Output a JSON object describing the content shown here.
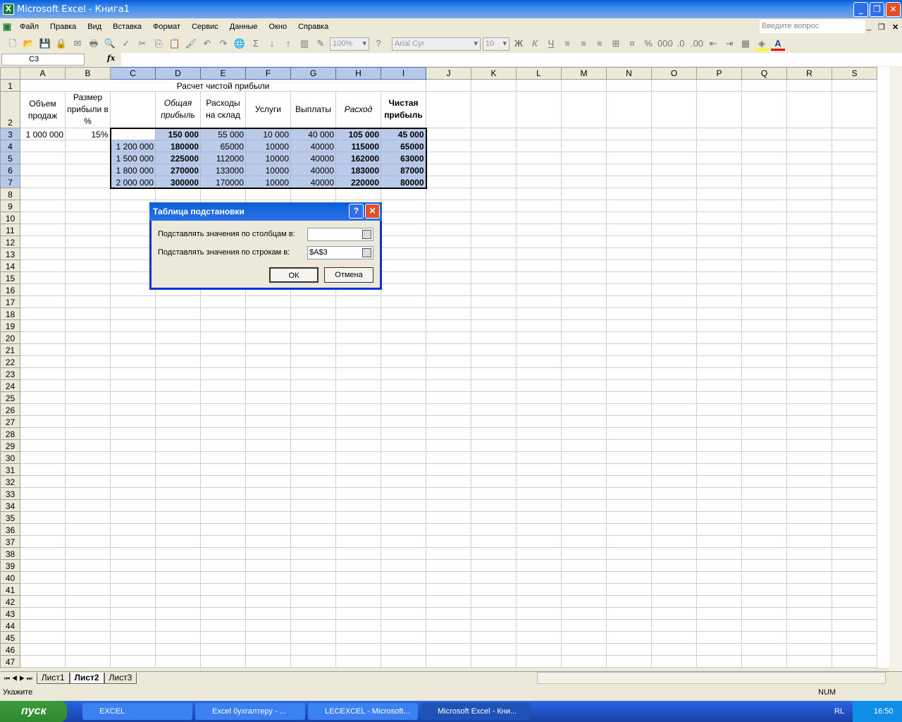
{
  "window": {
    "title": "Microsoft Excel - Книга1",
    "minimize": "_",
    "restore": "❐",
    "close": "✕"
  },
  "menu": [
    "Файл",
    "Правка",
    "Вид",
    "Вставка",
    "Формат",
    "Сервис",
    "Данные",
    "Окно",
    "Справка"
  ],
  "ask_placeholder": "Введите вопрос",
  "toolbar": {
    "zoom": "100%",
    "font": "Arial Cyr",
    "size": "10",
    "bold": "Ж",
    "italic": "К",
    "underline": "Ч"
  },
  "namebox": "C3",
  "fx": "fx",
  "columns": [
    "A",
    "B",
    "C",
    "D",
    "E",
    "F",
    "G",
    "H",
    "I",
    "J",
    "K",
    "L",
    "M",
    "N",
    "O",
    "P",
    "Q",
    "R",
    "S"
  ],
  "selection": {
    "range": "C3:I7"
  },
  "title_cell": "Расчет чистой прибыли",
  "headers": [
    "Объем продаж",
    "Размер прибыли в %",
    "",
    "Общая прибыль",
    "Расходы на склад",
    "Услуги",
    "Выплаты",
    "Расход",
    "Чистая прибыль"
  ],
  "rows": [
    [
      "1 000 000",
      "15%",
      "",
      "150 000",
      "55 000",
      "10 000",
      "40 000",
      "105 000",
      "45 000"
    ],
    [
      "",
      "",
      "1 200 000",
      "180000",
      "65000",
      "10000",
      "40000",
      "115000",
      "65000"
    ],
    [
      "",
      "",
      "1 500 000",
      "225000",
      "112000",
      "10000",
      "40000",
      "162000",
      "63000"
    ],
    [
      "",
      "",
      "1 800 000",
      "270000",
      "133000",
      "10000",
      "40000",
      "183000",
      "87000"
    ],
    [
      "",
      "",
      "2 000 000",
      "300000",
      "170000",
      "10000",
      "40000",
      "220000",
      "80000"
    ]
  ],
  "dialog": {
    "title": "Таблица подстановки",
    "help": "?",
    "close": "✕",
    "col_label": "Подставлять значения по столбцам в:",
    "col_value": "",
    "row_label": "Подставлять значения по строкам в:",
    "row_value": "$A$3",
    "ok": "ОК",
    "cancel": "Отмена"
  },
  "sheets": [
    "Лист1",
    "Лист2",
    "Лист3"
  ],
  "active_sheet": 1,
  "status": {
    "mode": "Укажите",
    "num": "NUM"
  },
  "taskbar": {
    "start": "пуск",
    "items": [
      "EXCEL",
      "Excel бухгалтеру - ...",
      "LECEXCEL - Microsoft...",
      "Microsoft Excel - Кни..."
    ],
    "lang": "RL",
    "time": "16:50"
  }
}
